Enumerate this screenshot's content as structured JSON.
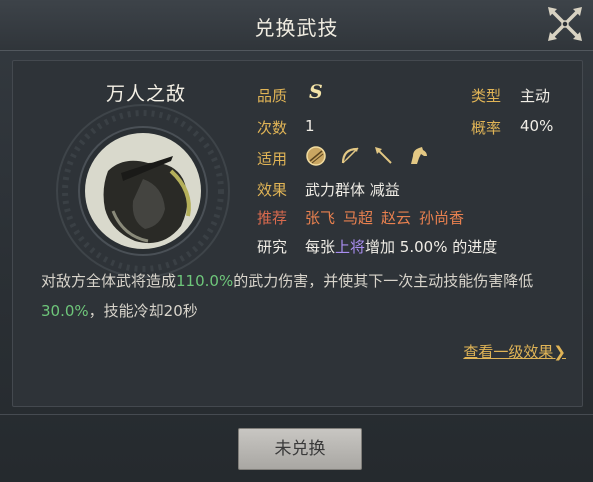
{
  "dialog": {
    "title": "兑换武技"
  },
  "skill": {
    "name": "万人之敌",
    "rows": {
      "quality_label": "品质",
      "quality_value": "S",
      "type_label": "类型",
      "type_value": "主动",
      "count_label": "次数",
      "count_value": "1",
      "rate_label": "概率",
      "rate_value": "40%",
      "applicable_label": "适用",
      "applicable_icons": [
        "shield-icon",
        "bow-icon",
        "spear-icon",
        "horse-icon"
      ],
      "effect_label": "效果",
      "effect_value": "武力群体 减益",
      "recommend_label": "推荐",
      "recommend_heroes": [
        "张飞",
        "马超",
        "赵云",
        "孙尚香"
      ],
      "research_label": "研究",
      "research_prefix": "每张",
      "research_highlight": "上将",
      "research_suffix": "增加 5.00% 的进度"
    },
    "description": {
      "part1": "对敌方全体武将造成",
      "value1": "110.0%",
      "part2": "的武力伤害，并使其下一次主动技能伤害降低",
      "value2": "30.0%",
      "part3": "，技能冷却20秒"
    },
    "view_link": "查看一级效果",
    "view_link_arrow": "❯"
  },
  "footer": {
    "button_label": "未兑换"
  },
  "colors": {
    "accent_gold": "#e0b456",
    "hero_orange": "#e8804f",
    "highlight_purple": "#a98ef0",
    "value_green": "#6ec67a"
  }
}
